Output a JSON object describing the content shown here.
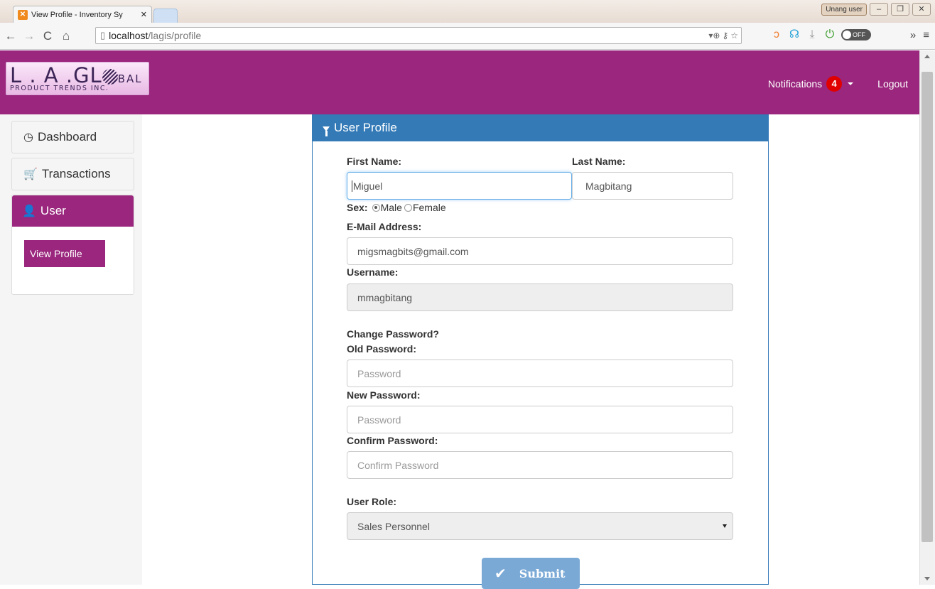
{
  "browser": {
    "tab_title": "View Profile - Inventory Sy",
    "tab_favicon": "xampp-favicon",
    "window_user": "Unang user",
    "url_host": "localhost",
    "url_path": "/lagis/profile",
    "toggle_label": "OFF"
  },
  "header": {
    "logo_main": "L . A .GL",
    "logo_main_tail": "BAL",
    "logo_sub": "PRODUCT TRENDS INC.",
    "notifications_label": "Notifications",
    "notifications_count": "4",
    "logout_label": "Logout",
    "bg_color": "#9a267d"
  },
  "sidebar": {
    "dashboard_label": "Dashboard",
    "transactions_label": "Transactions",
    "user_label": "User",
    "view_profile_label": "View Profile"
  },
  "panel": {
    "title": "User Profile",
    "header_color": "#337ab7"
  },
  "form": {
    "first_name_label": "First Name:",
    "first_name_value": "Miguel",
    "last_name_label": "Last Name:",
    "last_name_value": "Magbitang",
    "sex_label": "Sex:",
    "sex_male_label": "Male",
    "sex_female_label": "Female",
    "sex_selected": "Male",
    "email_label": "E-Mail Address:",
    "email_value": "migsmagbits@gmail.com",
    "username_label": "Username:",
    "username_value": "mmagbitang",
    "change_password_label": "Change Password?",
    "old_password_label": "Old Password:",
    "old_password_placeholder": "Password",
    "new_password_label": "New Password:",
    "new_password_placeholder": "Password",
    "confirm_password_label": "Confirm Password:",
    "confirm_password_placeholder": "Confirm Password",
    "user_role_label": "User Role:",
    "user_role_value": "Sales Personnel",
    "submit_label": "Submit"
  }
}
